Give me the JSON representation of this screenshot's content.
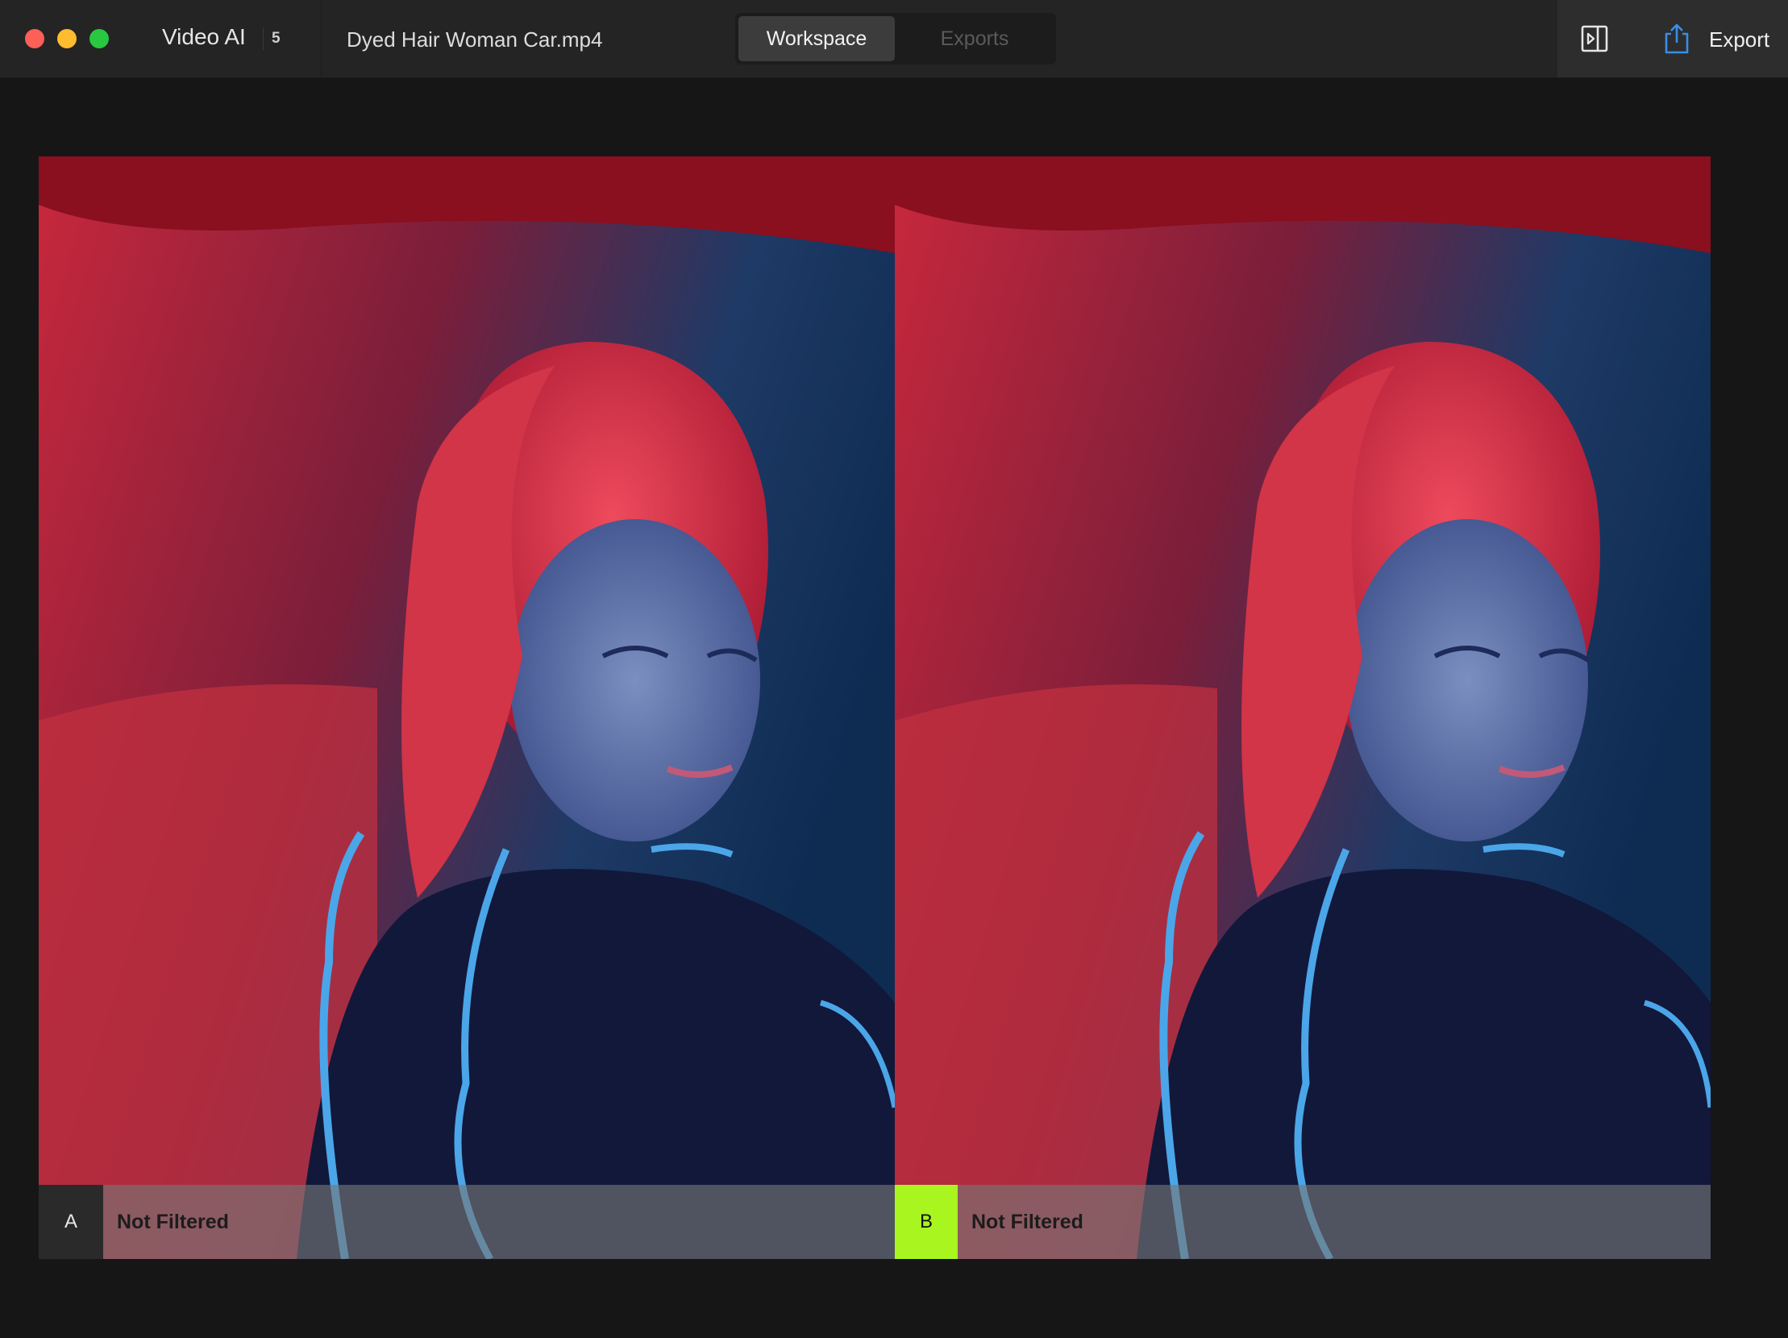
{
  "app": {
    "name": "Video AI",
    "badge": "5",
    "file_name": "Dyed Hair Woman Car.mp4"
  },
  "tabs": [
    {
      "label": "Workspace",
      "active": true
    },
    {
      "label": "Exports",
      "active": false
    }
  ],
  "toolbar": {
    "compare_icon": "split-view-icon",
    "export_label": "Export",
    "export_icon": "share-export-icon"
  },
  "panes": [
    {
      "tag": "A",
      "status": "Not Filtered"
    },
    {
      "tag": "B",
      "status": "Not Filtered"
    }
  ],
  "colors": {
    "accent": "#a8f520",
    "close": "#fe5f57",
    "minimize": "#febc2e",
    "maximize": "#28c840"
  }
}
